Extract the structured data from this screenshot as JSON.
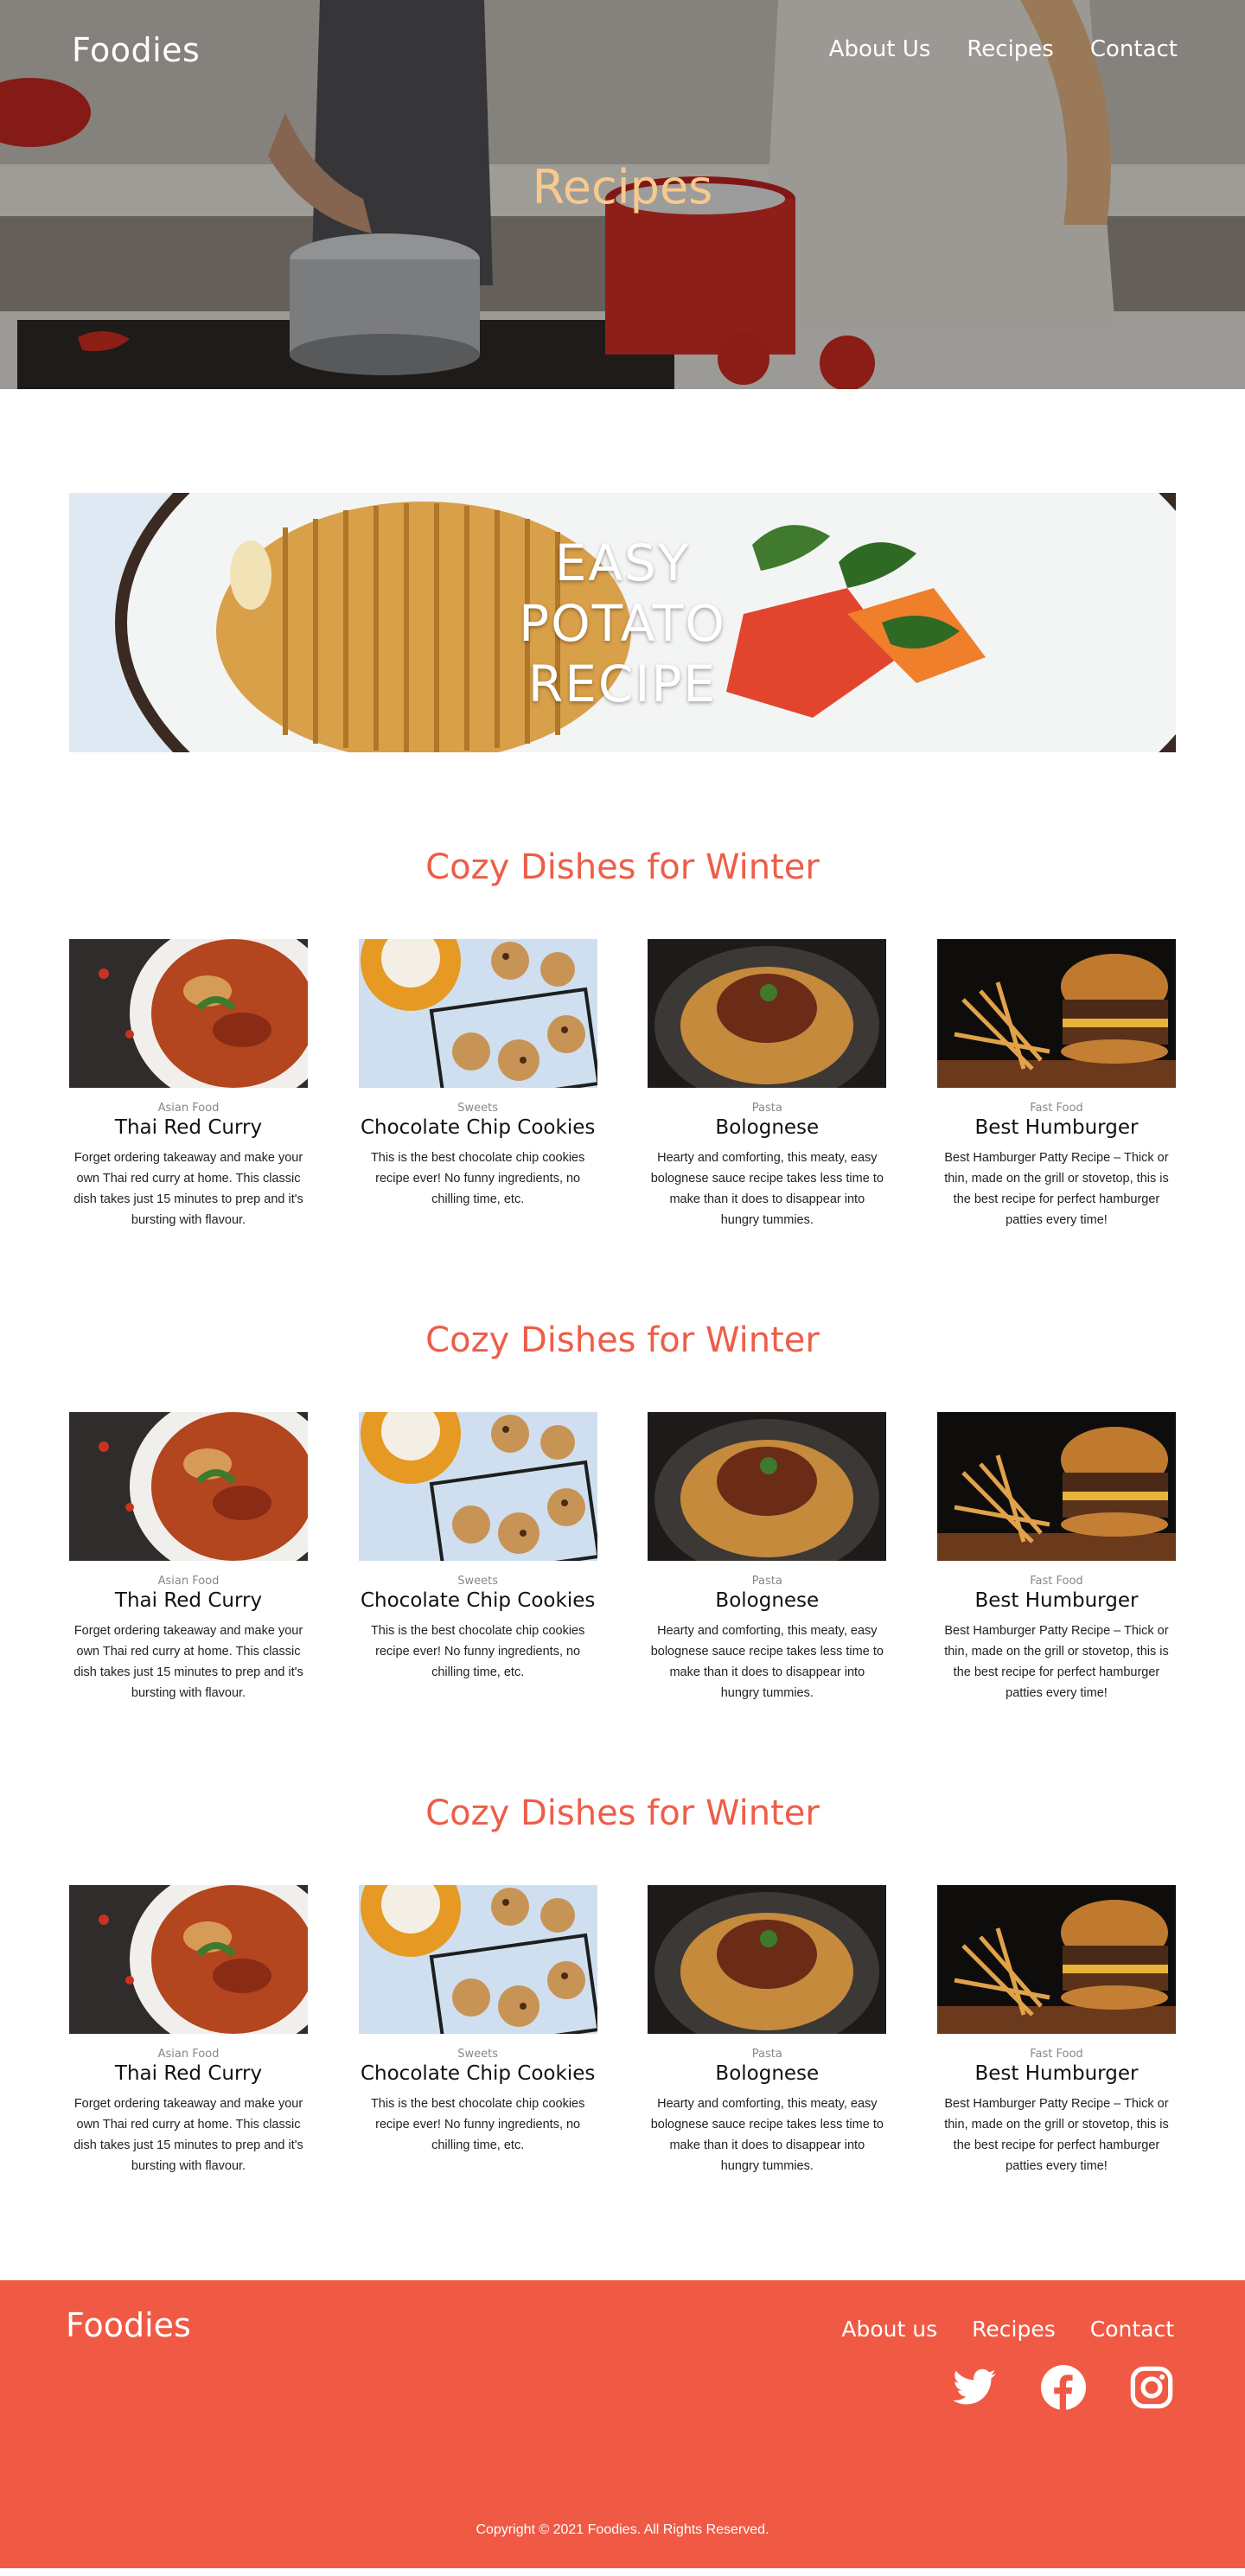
{
  "header": {
    "brand": "Foodies",
    "nav": [
      "About Us",
      "Recipes",
      "Contact"
    ],
    "title": "Recipes"
  },
  "feature": {
    "lines": [
      "EASY",
      "POTATO",
      "RECIPE"
    ]
  },
  "sections": [
    {
      "title": "Cozy Dishes for Winter",
      "cards": [
        {
          "category": "Asian Food",
          "title": "Thai Red Curry",
          "description": "Forget ordering takeaway and make your own Thai red curry at home. This classic dish takes just 15 minutes to prep and it's bursting with flavour.",
          "image": "curry-photo"
        },
        {
          "category": "Sweets",
          "title": "Chocolate Chip Cookies",
          "description": "This is the best chocolate chip cookies recipe ever! No funny ingredients, no chilling time, etc.",
          "image": "cookies-photo"
        },
        {
          "category": "Pasta",
          "title": "Bolognese",
          "description": "Hearty and comforting, this meaty, easy bolognese sauce recipe takes less time to make than it does to disappear into hungry tummies.",
          "image": "bolognese-photo"
        },
        {
          "category": "Fast Food",
          "title": "Best Humburger",
          "description": "Best Hamburger Patty Recipe – Thick or thin, made on the grill or stovetop, this is the best recipe for perfect hamburger patties every time!",
          "image": "burger-photo"
        }
      ]
    },
    {
      "title": "Cozy Dishes for Winter",
      "cards": [
        {
          "category": "Asian Food",
          "title": "Thai Red Curry",
          "description": "Forget ordering takeaway and make your own Thai red curry at home. This classic dish takes just 15 minutes to prep and it's bursting with flavour.",
          "image": "curry-photo"
        },
        {
          "category": "Sweets",
          "title": "Chocolate Chip Cookies",
          "description": "This is the best chocolate chip cookies recipe ever! No funny ingredients, no chilling time, etc.",
          "image": "cookies-photo"
        },
        {
          "category": "Pasta",
          "title": "Bolognese",
          "description": "Hearty and comforting, this meaty, easy bolognese sauce recipe takes less time to make than it does to disappear into hungry tummies.",
          "image": "bolognese-photo"
        },
        {
          "category": "Fast Food",
          "title": "Best Humburger",
          "description": "Best Hamburger Patty Recipe – Thick or thin, made on the grill or stovetop, this is the best recipe for perfect hamburger patties every time!",
          "image": "burger-photo"
        }
      ]
    },
    {
      "title": "Cozy Dishes for Winter",
      "cards": [
        {
          "category": "Asian Food",
          "title": "Thai Red Curry",
          "description": "Forget ordering takeaway and make your own Thai red curry at home. This classic dish takes just 15 minutes to prep and it's bursting with flavour.",
          "image": "curry-photo"
        },
        {
          "category": "Sweets",
          "title": "Chocolate Chip Cookies",
          "description": "This is the best chocolate chip cookies recipe ever! No funny ingredients, no chilling time, etc.",
          "image": "cookies-photo"
        },
        {
          "category": "Pasta",
          "title": "Bolognese",
          "description": "Hearty and comforting, this meaty, easy bolognese sauce recipe takes less time to make than it does to disappear into hungry tummies.",
          "image": "bolognese-photo"
        },
        {
          "category": "Fast Food",
          "title": "Best Humburger",
          "description": "Best Hamburger Patty Recipe – Thick or thin, made on the grill or stovetop, this is the best recipe for perfect hamburger patties every time!",
          "image": "burger-photo"
        }
      ]
    }
  ],
  "footer": {
    "brand": "Foodies",
    "nav": [
      "About us",
      "Recipes",
      "Contact"
    ],
    "socials": [
      "twitter-icon",
      "facebook-icon",
      "instagram-icon"
    ],
    "copyright": "Copyright © 2021 Foodies. All Rights Reserved."
  },
  "colors": {
    "accent": "#f05a45",
    "section_title": "#ee5d48",
    "hero_title": "#f7c98e"
  }
}
